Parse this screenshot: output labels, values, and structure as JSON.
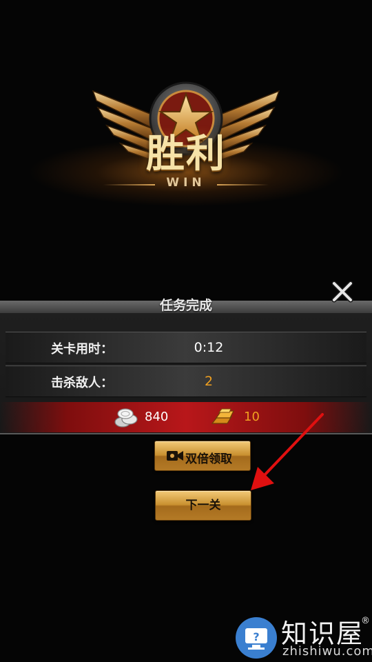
{
  "victory": {
    "title": "胜利",
    "subtitle": "WIN"
  },
  "panel": {
    "title": "任务完成",
    "stats": [
      {
        "label": "关卡用时：",
        "value": "0:12",
        "value_color": "#ffffff"
      },
      {
        "label": "击杀敌人：",
        "value": "2",
        "value_color": "#f0a020"
      }
    ],
    "rewards": {
      "silver": {
        "icon": "silver-coins-icon",
        "value": "840"
      },
      "gold": {
        "icon": "gold-bars-icon",
        "value": "10"
      }
    }
  },
  "buttons": {
    "double_claim": "双倍领取",
    "next_level": "下一关"
  },
  "watermark": {
    "name": "知识屋",
    "registered": "®",
    "url": "zhishiwu.com"
  },
  "colors": {
    "accent_gold": "#d9a457",
    "reward_red": "#b8171a",
    "button_gold": "#e0b062",
    "arrow_red": "#e01010"
  }
}
